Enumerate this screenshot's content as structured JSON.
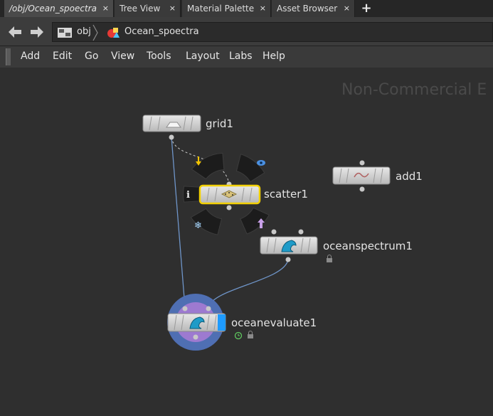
{
  "tabs": [
    {
      "label": "/obj/Ocean_spoectra",
      "close": "×",
      "active": true
    },
    {
      "label": "Tree View",
      "close": "×"
    },
    {
      "label": "Material Palette",
      "close": "×"
    },
    {
      "label": "Asset Browser",
      "close": "×"
    }
  ],
  "tab_add": "+",
  "path": {
    "root": "obj",
    "node": "Ocean_spoectra"
  },
  "menu": [
    "Add",
    "Edit",
    "Go",
    "View",
    "Tools",
    "Layout",
    "Labs",
    "Help"
  ],
  "watermark": "Non-Commercial E",
  "nodes": {
    "grid": "grid1",
    "scatter": "scatter1",
    "add": "add1",
    "spectrum": "oceanspectrum1",
    "evaluate": "oceanevaluate1"
  },
  "colors": {
    "selected_outline": "#f2d000",
    "wire": "#6f95c9",
    "evaluate_ring_outer": "#4f6fb3",
    "evaluate_ring_inner": "#9d7ad0",
    "display_flag": "#1e9bff"
  }
}
